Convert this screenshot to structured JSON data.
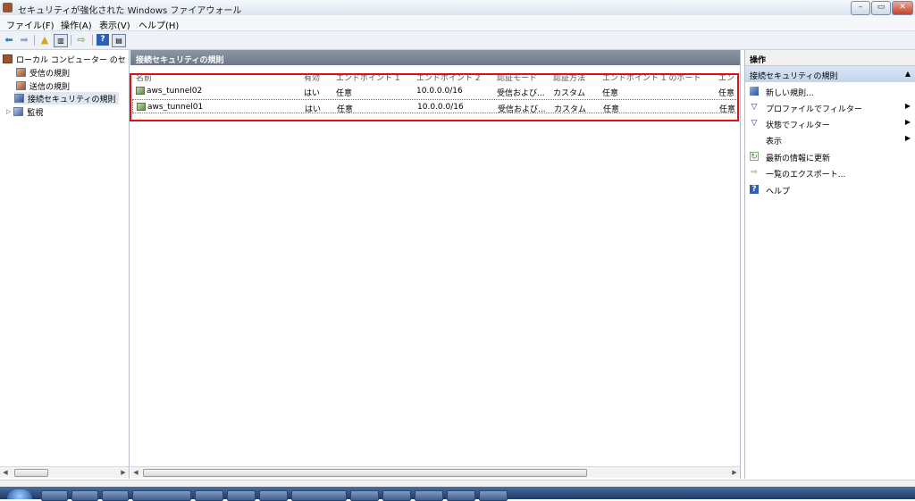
{
  "window": {
    "title": "セキュリティが強化された Windows ファイアウォール"
  },
  "window_controls": {
    "minimize": "–",
    "restore": "▭",
    "close": "✕"
  },
  "menu": {
    "items": [
      "ファイル(F)",
      "操作(A)",
      "表示(V)",
      "ヘルプ(H)"
    ]
  },
  "toolbar": {
    "icons": [
      "back-arrow-icon",
      "forward-arrow-icon",
      "up-folder-icon",
      "show-hide-tree-icon",
      "export-icon",
      "help-icon",
      "action-pane-icon"
    ]
  },
  "tree": {
    "root": "ローカル コンピューター のセ",
    "items": [
      "受信の規則",
      "送信の規則",
      "接続セキュリティの規則"
    ],
    "monitor": "監視"
  },
  "center": {
    "title": "接続セキュリティの規則",
    "columns": [
      "名前",
      "有効",
      "エンドポイント 1",
      "エンドポイント 2",
      "認証モード",
      "認証方法",
      "エンドポイント 1 のポート",
      "エン"
    ],
    "rows": [
      [
        "aws_tunnel02",
        "はい",
        "任意",
        "10.0.0.0/16",
        "受信および...",
        "カスタム",
        "任意",
        "任意"
      ],
      [
        "aws_tunnel01",
        "はい",
        "任意",
        "10.0.0.0/16",
        "受信および...",
        "カスタム",
        "任意",
        "任意"
      ]
    ]
  },
  "actions": {
    "header": "操作",
    "section": "接続セキュリティの規則",
    "items": [
      {
        "label": "新しい規則...",
        "icon": "new-rule-icon"
      },
      {
        "label": "プロファイルでフィルター",
        "icon": "filter-icon"
      },
      {
        "label": "状態でフィルター",
        "icon": "filter-icon"
      },
      {
        "label": "表示",
        "icon": ""
      },
      {
        "label": "最新の情報に更新",
        "icon": "refresh-icon"
      },
      {
        "label": "一覧のエクスポート...",
        "icon": "export-icon"
      },
      {
        "label": "ヘルプ",
        "icon": "help-icon"
      }
    ]
  },
  "colors": {
    "highlight_box": "#e01010",
    "section_header": "#7a8491",
    "selection": "#c4d6ec"
  }
}
